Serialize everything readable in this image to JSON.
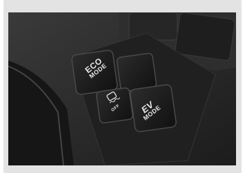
{
  "image": {
    "subject": "car center console drive mode switch panel",
    "buttons": [
      {
        "name": "eco-mode-button",
        "lines": [
          "ECO",
          "MODE"
        ]
      },
      {
        "name": "blank-switch",
        "lines": []
      },
      {
        "name": "traction-control-off-button",
        "lines": [
          "OFF"
        ]
      },
      {
        "name": "ev-mode-button",
        "lines": [
          "EV",
          "MODE"
        ]
      }
    ],
    "colors": {
      "frame": "#e3e3e3",
      "console": "#242424",
      "button": "#1a1a1a",
      "label": "#e8e8e8"
    }
  }
}
